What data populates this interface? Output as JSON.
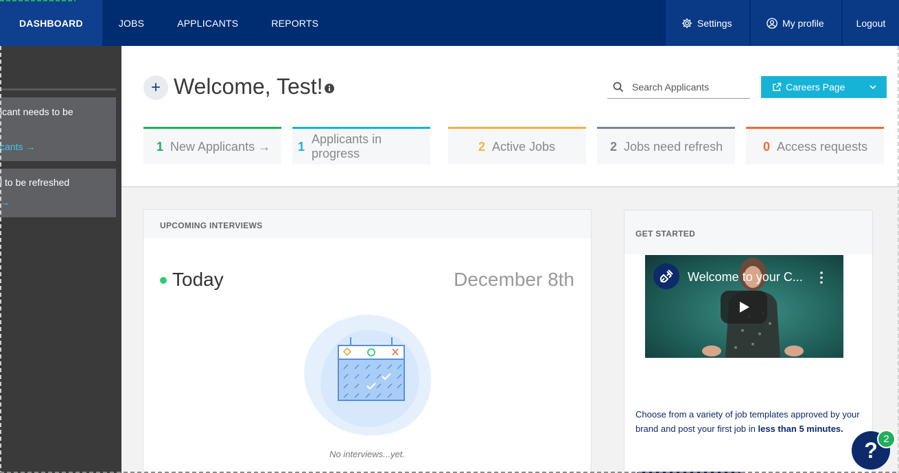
{
  "nav": {
    "items": [
      {
        "label": "DASHBOARD",
        "active": true
      },
      {
        "label": "JOBS"
      },
      {
        "label": "APPLICANTS"
      },
      {
        "label": "REPORTS"
      }
    ],
    "settings_label": "Settings",
    "profile_label": "My profile",
    "logout_label": "Logout"
  },
  "sidepanel": {
    "cards": [
      {
        "text": "icant needs to be",
        "link": "cants →"
      },
      {
        "text": "l to be refreshed",
        "link": "→"
      }
    ]
  },
  "header": {
    "plus": "+",
    "welcome": "Welcome, Test!",
    "search_placeholder": "Search Applicants",
    "careers_label": "Careers Page"
  },
  "stats": [
    {
      "num": "1",
      "label": "New Applicants →",
      "color": "#1fae5a"
    },
    {
      "num": "1",
      "label": "Applicants in progress",
      "color": "#17b3d6"
    },
    {
      "num": "2",
      "label": "Active Jobs",
      "color": "#f3b33d"
    },
    {
      "num": "2",
      "label": "Jobs need refresh",
      "color": "#7d8491"
    },
    {
      "num": "0",
      "label": "Access requests",
      "color": "#f06a35"
    }
  ],
  "interviews": {
    "heading": "UPCOMING INTERVIEWS",
    "today": "Today",
    "date": "December 8th",
    "empty": "No interviews...yet."
  },
  "get_started": {
    "heading": "GET STARTED",
    "video_title": "Welcome to your C...",
    "text_before": "Choose from a variety of job templates approved by your brand and post your first job in ",
    "text_bold": "less than 5 minutes."
  },
  "help": {
    "icon_text": "?",
    "badge": "2"
  },
  "colors": {
    "nav_bg": "#002d72",
    "accent_cyan": "#17b3d6",
    "navy": "#0d2a6b"
  }
}
